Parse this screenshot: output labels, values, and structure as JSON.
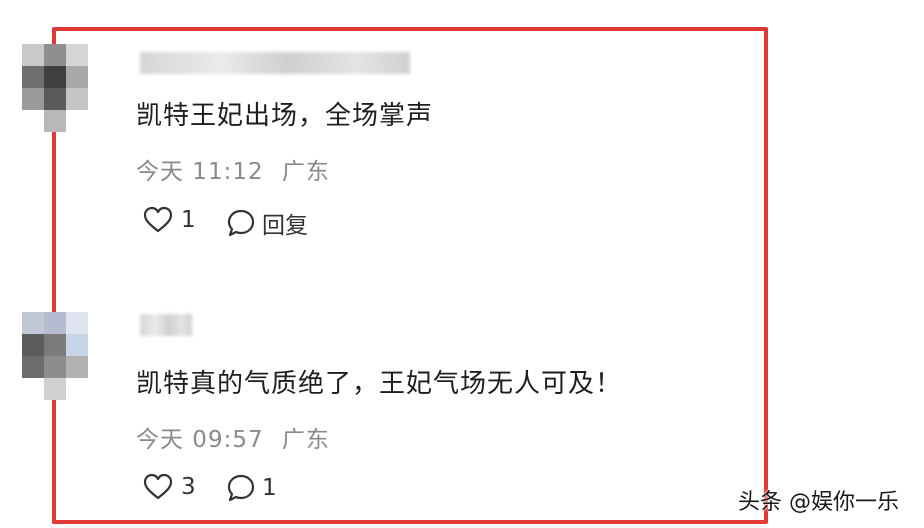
{
  "comments": [
    {
      "text": "凯特王妃出场，全场掌声",
      "time": "今天 11:12",
      "location": "广东",
      "likes": "1",
      "reply_label": "回复"
    },
    {
      "text": "凯特真的气质绝了，王妃气场无人可及！",
      "time": "今天 09:57",
      "location": "广东",
      "likes": "3",
      "replies": "1"
    }
  ],
  "watermark": "头条 @娱你一乐",
  "colors": {
    "highlight_border": "#e03a36",
    "meta_text": "#8a8a8a"
  },
  "icons": {
    "like": "heart-outline-icon",
    "comment": "speech-bubble-icon"
  }
}
